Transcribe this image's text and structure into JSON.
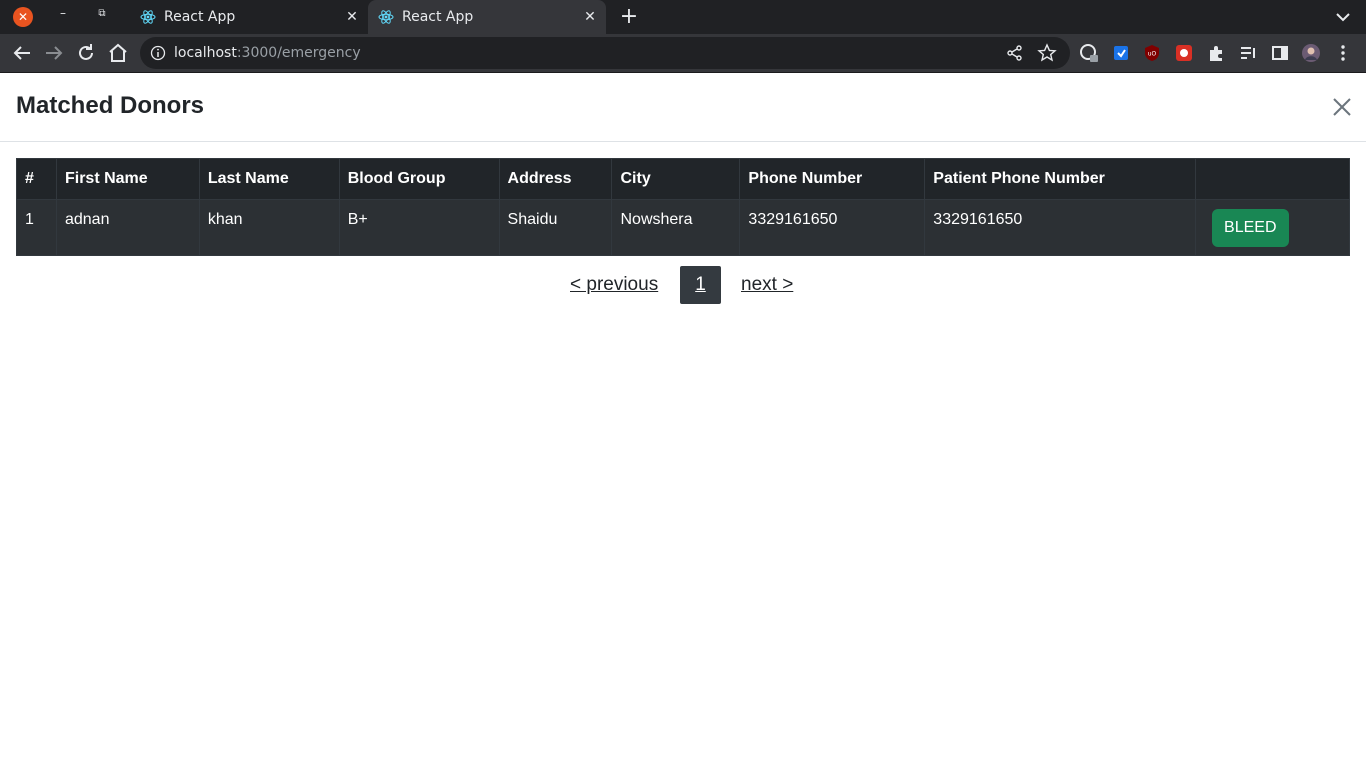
{
  "browser": {
    "tabs": [
      {
        "title": "React App",
        "active": false
      },
      {
        "title": "React App",
        "active": true
      }
    ],
    "url_host": "localhost",
    "url_path": ":3000/emergency"
  },
  "modal": {
    "title": "Matched Donors"
  },
  "table": {
    "headers": [
      "#",
      "First Name",
      "Last Name",
      "Blood Group",
      "Address",
      "City",
      "Phone Number",
      "Patient Phone Number",
      ""
    ],
    "rows": [
      {
        "index": "1",
        "first_name": "adnan",
        "last_name": "khan",
        "blood_group": "B+",
        "address": "Shaidu",
        "city": "Nowshera",
        "phone": "3329161650",
        "patient_phone": "3329161650",
        "action_label": "BLEED"
      }
    ]
  },
  "pagination": {
    "previous_label": "< previous",
    "current_page": "1",
    "next_label": "next >"
  },
  "colors": {
    "table_dark": "#212529",
    "bleed_button": "#198754",
    "active_page": "#343a40"
  }
}
